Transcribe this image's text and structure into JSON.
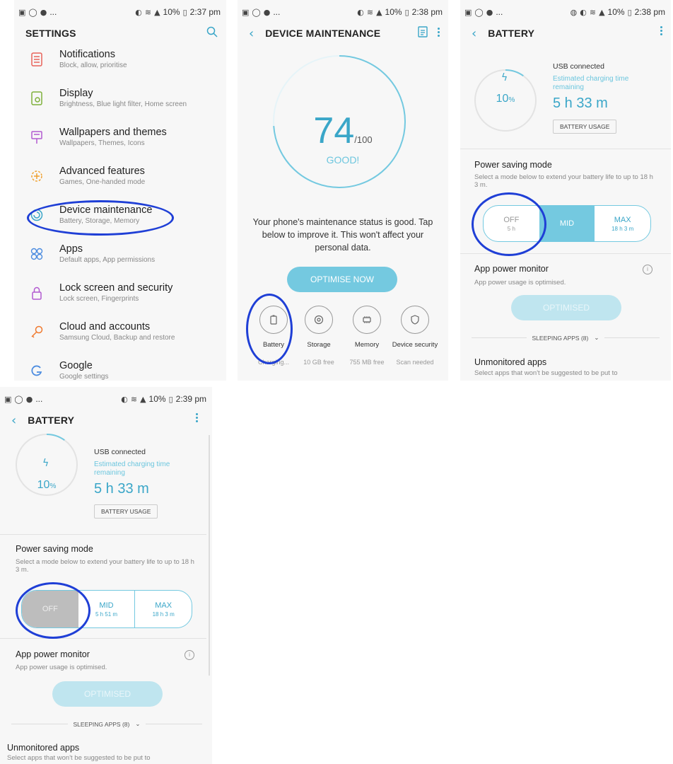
{
  "screens": {
    "settings": {
      "status": {
        "time": "2:37 pm",
        "battery": "10%"
      },
      "title": "SETTINGS",
      "items": [
        {
          "title": "Notifications",
          "subtitle": "Block, allow, prioritise",
          "icon": "notifications-icon",
          "color": "#e8635a"
        },
        {
          "title": "Display",
          "subtitle": "Brightness, Blue light filter, Home screen",
          "icon": "display-icon",
          "color": "#7fb03b"
        },
        {
          "title": "Wallpapers and themes",
          "subtitle": "Wallpapers, Themes, Icons",
          "icon": "wallpaper-icon",
          "color": "#b25bd1"
        },
        {
          "title": "Advanced features",
          "subtitle": "Games, One-handed mode",
          "icon": "advanced-features-icon",
          "color": "#f0a12f"
        },
        {
          "title": "Device maintenance",
          "subtitle": "Battery, Storage, Memory",
          "icon": "device-maintenance-icon",
          "color": "#3aa6c8"
        },
        {
          "title": "Apps",
          "subtitle": "Default apps, App permissions",
          "icon": "apps-icon",
          "color": "#4c8ce0"
        },
        {
          "title": "Lock screen and security",
          "subtitle": "Lock screen, Fingerprints",
          "icon": "lock-icon",
          "color": "#b25bd1"
        },
        {
          "title": "Cloud and accounts",
          "subtitle": "Samsung Cloud, Backup and restore",
          "icon": "key-icon",
          "color": "#f07a2f"
        },
        {
          "title": "Google",
          "subtitle": "Google settings",
          "icon": "google-icon",
          "color": "#4c8ce0"
        }
      ]
    },
    "maintenance": {
      "status": {
        "time": "2:38 pm",
        "battery": "10%"
      },
      "title": "DEVICE MAINTENANCE",
      "score": "74",
      "score_max": "/100",
      "rating": "GOOD!",
      "message": "Your phone's maintenance status is good. Tap below to improve it. This won't affect your personal data.",
      "optimise_label": "OPTIMISE NOW",
      "categories": [
        {
          "label": "Battery",
          "value": "Charging..."
        },
        {
          "label": "Storage",
          "value": "10 GB free"
        },
        {
          "label": "Memory",
          "value": "755 MB free"
        },
        {
          "label": "Device security",
          "value": "Scan needed"
        }
      ]
    },
    "battery": {
      "status_a": {
        "time": "2:38 pm",
        "battery": "10%"
      },
      "status_b": {
        "time": "2:39 pm",
        "battery": "10%"
      },
      "title": "BATTERY",
      "percent": "10",
      "percent_unit": "%",
      "usb": "USB connected",
      "est_label": "Estimated charging time remaining",
      "charge_time": "5 h 33 m",
      "usage_button": "BATTERY USAGE",
      "psm_title": "Power saving mode",
      "psm_desc": "Select a mode below to extend your battery life to up to 18 h 3 m.",
      "modes_a": [
        {
          "label": "OFF",
          "value": "5 h"
        },
        {
          "label": "MID",
          "value": ""
        },
        {
          "label": "MAX",
          "value": "18 h 3 m"
        }
      ],
      "modes_b": [
        {
          "label": "OFF",
          "value": ""
        },
        {
          "label": "MID",
          "value": "5 h 51 m"
        },
        {
          "label": "MAX",
          "value": "18 h 3 m"
        }
      ],
      "apm_title": "App power monitor",
      "apm_desc": "App power usage is optimised.",
      "optimised_label": "OPTIMISED",
      "sleeping_label": "SLEEPING APPS (8)",
      "unmon_title": "Unmonitored apps",
      "unmon_desc": "Select apps that won't be suggested to be put to"
    }
  },
  "colors": {
    "accent": "#3aa6c8",
    "highlight": "#1f3fd6",
    "selected_off": "#bdbdbd"
  }
}
